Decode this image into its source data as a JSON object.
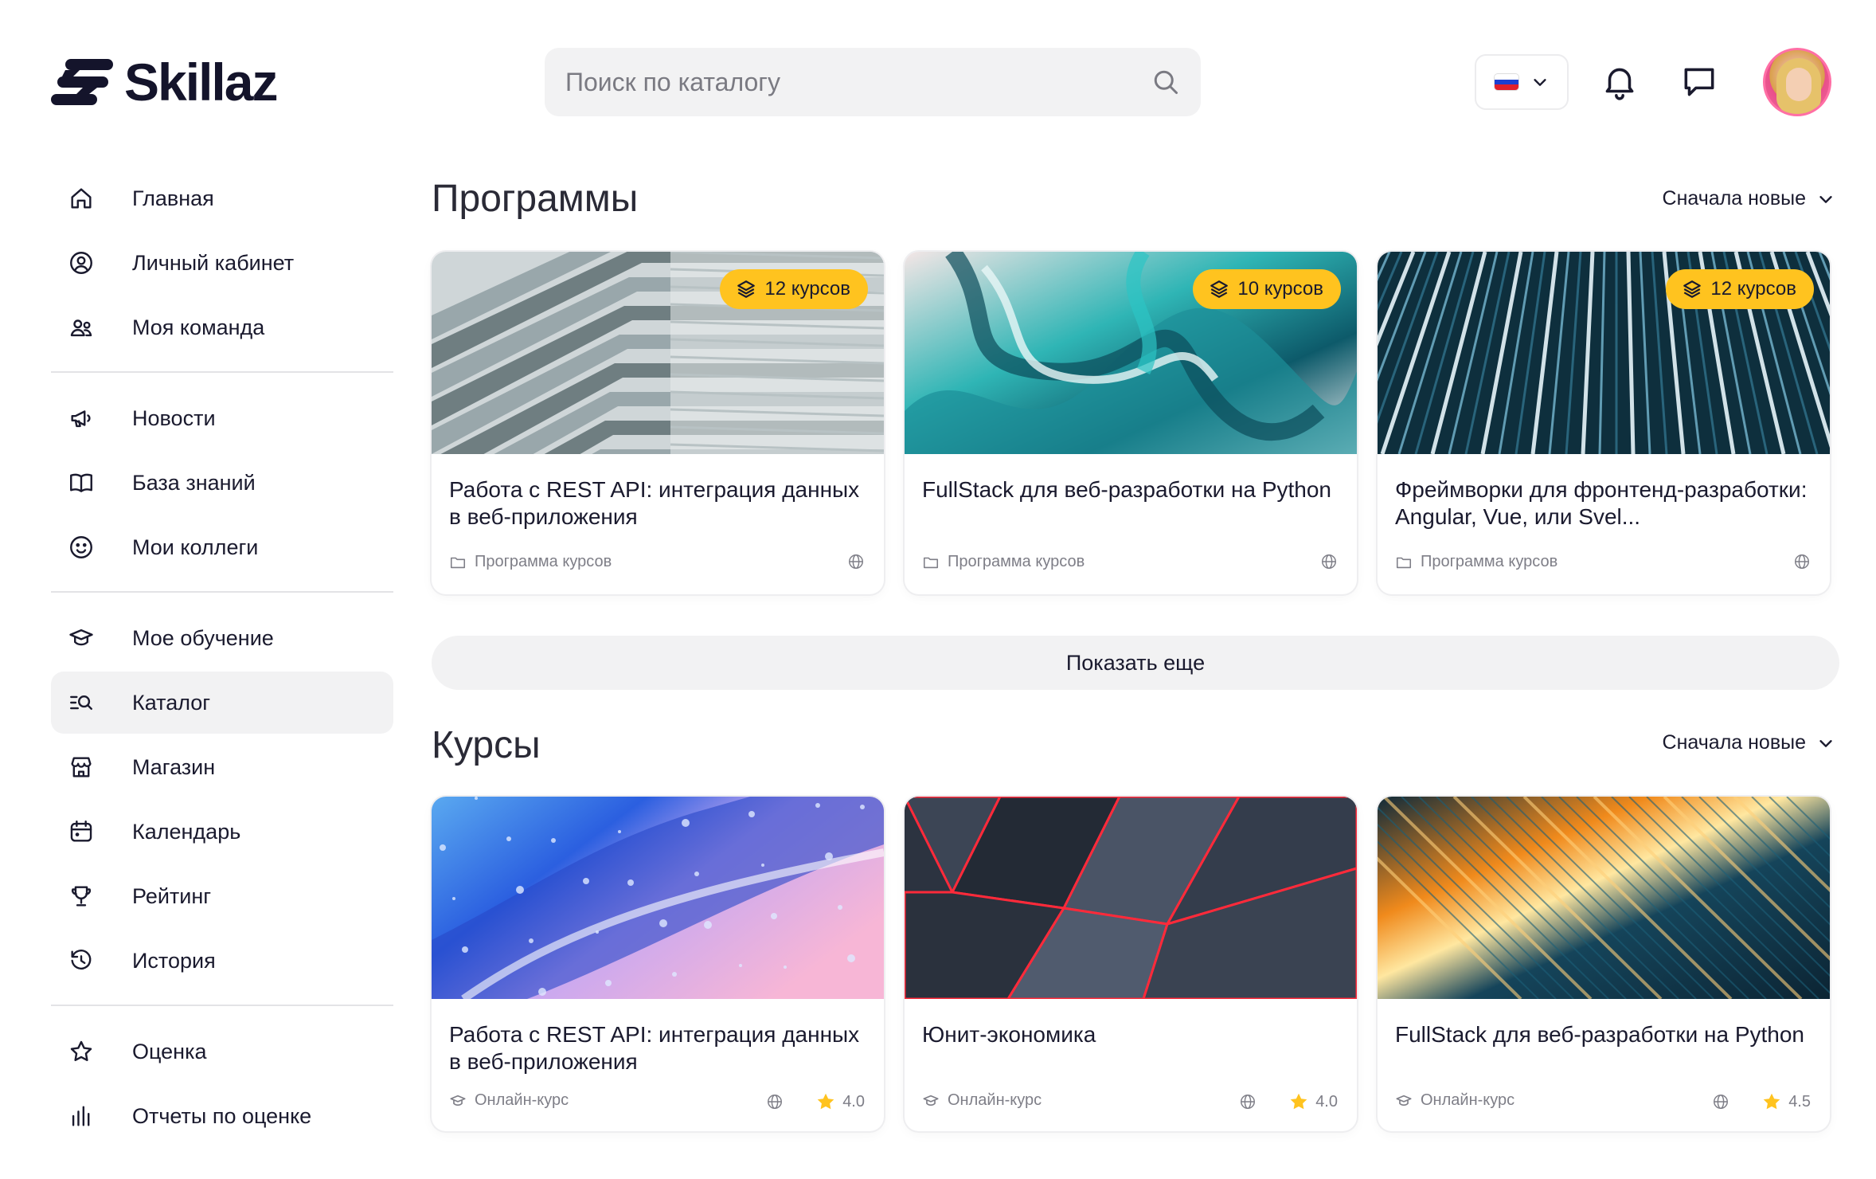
{
  "brand": {
    "name": "Skillaz"
  },
  "search": {
    "placeholder": "Поиск по каталогу"
  },
  "sidebar": {
    "groups": [
      [
        {
          "label": "Главная",
          "icon": "home-icon"
        },
        {
          "label": "Личный кабинет",
          "icon": "user-circle-icon"
        },
        {
          "label": "Моя команда",
          "icon": "team-icon"
        }
      ],
      [
        {
          "label": "Новости",
          "icon": "megaphone-icon"
        },
        {
          "label": "База знаний",
          "icon": "book-icon"
        },
        {
          "label": "Мои коллеги",
          "icon": "smile-icon"
        }
      ],
      [
        {
          "label": "Мое обучение",
          "icon": "graduation-cap-icon"
        },
        {
          "label": "Каталог",
          "icon": "catalog-search-icon",
          "active": true
        },
        {
          "label": "Магазин",
          "icon": "store-icon"
        },
        {
          "label": "Календарь",
          "icon": "calendar-icon"
        },
        {
          "label": "Рейтинг",
          "icon": "trophy-icon"
        },
        {
          "label": "История",
          "icon": "history-icon"
        }
      ],
      [
        {
          "label": "Оценка",
          "icon": "star-icon"
        },
        {
          "label": "Отчеты по оценке",
          "icon": "bar-chart-icon"
        }
      ]
    ]
  },
  "programs": {
    "title": "Программы",
    "sort_label": "Сначала новые",
    "more_label": "Показать еще",
    "cards": [
      {
        "title": "Работа с REST API: интеграция данных в веб-приложения",
        "badge": "12 курсов",
        "type": "Программа курсов"
      },
      {
        "title": "FullStack для веб-разработки на Python",
        "badge": "10 курсов",
        "type": "Программа курсов"
      },
      {
        "title": "Фреймворки для фронтенд-разработки: Angular, Vue, или Svel...",
        "badge": "12 курсов",
        "type": "Программа курсов"
      }
    ]
  },
  "courses": {
    "title": "Курсы",
    "sort_label": "Сначала новые",
    "cards": [
      {
        "title": "Работа с REST API: интеграция данных в веб-приложения",
        "type": "Онлайн-курс",
        "rating": "4.0"
      },
      {
        "title": "Юнит-экономика",
        "type": "Онлайн-курс",
        "rating": "4.0"
      },
      {
        "title": "FullStack для веб-разработки на Python",
        "type": "Онлайн-курс",
        "rating": "4.5"
      }
    ]
  },
  "colors": {
    "accent": "#ffc31f",
    "active_bg": "#f2f2f3",
    "text": "#1a1a2e",
    "muted": "#7e7e87"
  }
}
